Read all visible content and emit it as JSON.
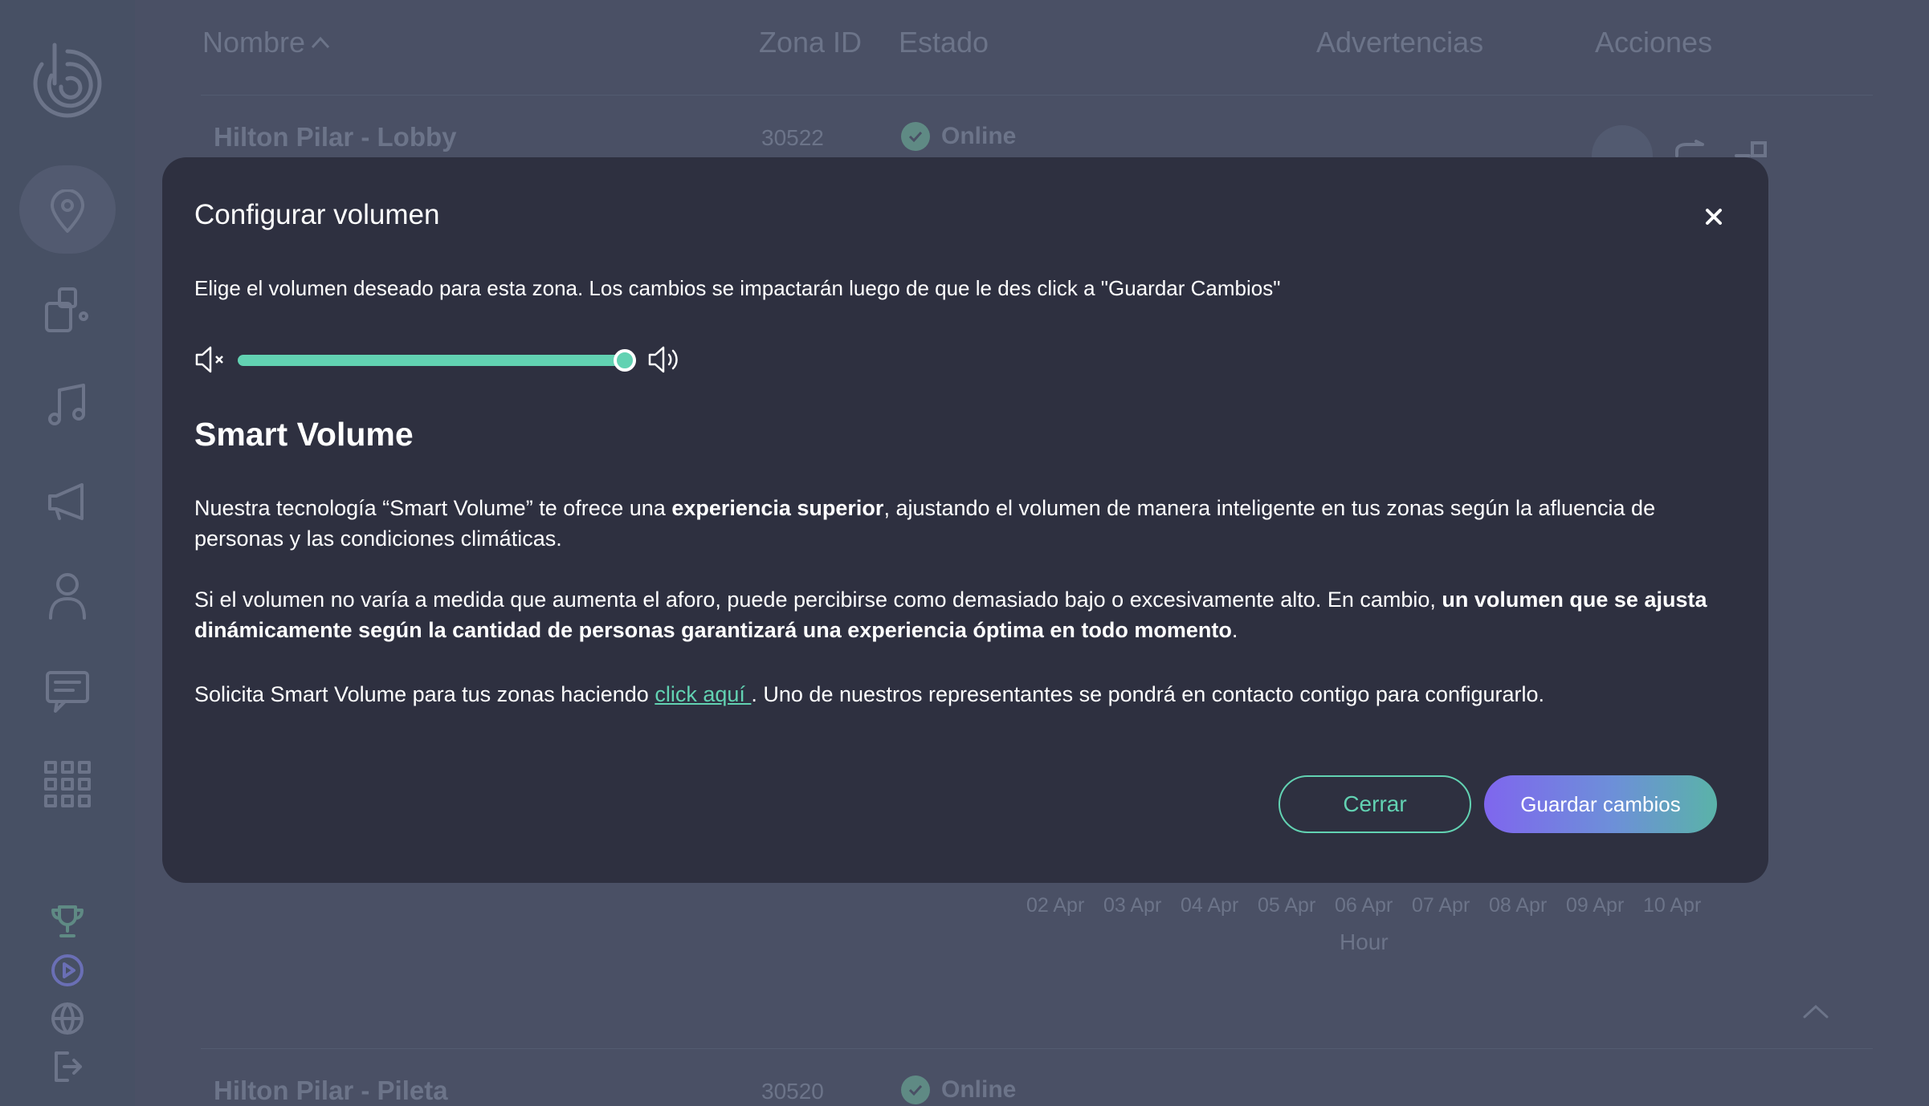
{
  "table": {
    "headers": {
      "nombre": "Nombre",
      "zona_id": "Zona ID",
      "estado": "Estado",
      "advertencias": "Advertencias",
      "acciones": "Acciones"
    },
    "rows": [
      {
        "name": "Hilton Pilar - Lobby",
        "zone_id": "30522",
        "status": "Online"
      },
      {
        "name": "Hilton Pilar - Pileta",
        "zone_id": "30520",
        "status": "Online"
      }
    ],
    "chart": {
      "x_ticks": [
        "02 Apr",
        "03 Apr",
        "04 Apr",
        "05 Apr",
        "06 Apr",
        "07 Apr",
        "08 Apr",
        "09 Apr",
        "10 Apr"
      ],
      "x_label": "Hour"
    }
  },
  "modal": {
    "title": "Configurar volumen",
    "description": "Elige el volumen deseado para esta zona. Los cambios se impactarán luego de que le des click a \"Guardar Cambios\"",
    "volume_level": 1.0,
    "smart_volume_title": "Smart Volume",
    "p1_a": "Nuestra tecnología “Smart Volume” te ofrece una ",
    "p1_b": "experiencia superior",
    "p1_c": ", ajustando el volumen de manera inteligente en tus zonas según la afluencia de personas y las condiciones climáticas.",
    "p2_a": "Si el volumen no varía a medida que aumenta el aforo, puede percibirse como demasiado bajo o excesivamente alto. En cambio, ",
    "p2_b": "un volumen que se ajusta dinámicamente según la cantidad de personas garantizará una experiencia óptima en todo momento",
    "p2_c": ".",
    "p3_a": "Solicita Smart Volume para tus zonas haciendo ",
    "p3_link": "click aquí ",
    "p3_b": ". Uno de nuestros representantes se pondrá en contacto contigo para configurarlo.",
    "close_button": "Cerrar",
    "save_button": "Guardar cambios"
  },
  "colors": {
    "accent": "#62d2b2",
    "modal_bg": "#2e3040",
    "overlay_bg": "#4a5065",
    "primary_gradient_start": "#7f66ee"
  }
}
